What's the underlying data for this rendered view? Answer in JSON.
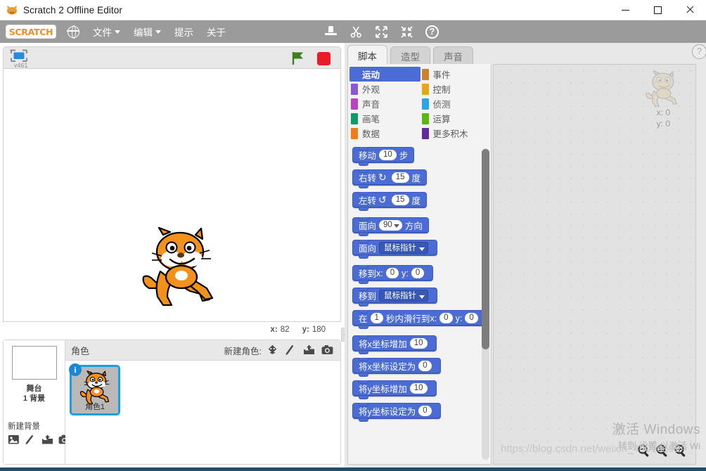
{
  "window": {
    "title": "Scratch 2 Offline Editor",
    "app_icon": "scratch-cat-icon",
    "minimize": "–",
    "maximize": "□",
    "close": "×"
  },
  "menubar": {
    "logo": "SCRATCH",
    "language_icon": "globe-icon",
    "items": [
      {
        "label": "文件",
        "has_caret": true
      },
      {
        "label": "编辑",
        "has_caret": true
      },
      {
        "label": "提示",
        "has_caret": false
      },
      {
        "label": "关于",
        "has_caret": false
      }
    ],
    "tools": [
      {
        "icon": "stamp-icon",
        "glyph": ""
      },
      {
        "icon": "scissors-icon",
        "glyph": "✂"
      },
      {
        "icon": "grow-icon",
        "glyph": "⤡"
      },
      {
        "icon": "shrink-icon",
        "glyph": "⤢"
      },
      {
        "icon": "help-icon",
        "glyph": "?"
      }
    ]
  },
  "stage": {
    "presentation_label": "v461",
    "green_flag_icon": "green-flag-icon",
    "stop_icon": "stop-sign-icon",
    "sprite_image": "scratch-cat",
    "coords": {
      "x_label": "x:",
      "x_value": "82",
      "y_label": "y:",
      "y_value": "180"
    }
  },
  "sprite_pane": {
    "header_title": "角色",
    "new_sprite_label": "新建角色:",
    "new_sprite_icons": [
      "new-sprite-face-icon",
      "paint-brush-icon",
      "upload-file-icon",
      "camera-icon"
    ],
    "stage_selector": {
      "name": "舞台",
      "backdrop_count": "1 背景",
      "new_backdrop_label": "新建背景",
      "new_backdrop_icons": [
        "image-library-icon",
        "paint-brush-icon",
        "upload-file-icon",
        "camera-icon"
      ]
    },
    "sprites": [
      {
        "name": "角色1",
        "badge": "i",
        "selected": true
      }
    ]
  },
  "editor": {
    "tabs": [
      {
        "label": "脚本",
        "active": true
      },
      {
        "label": "造型",
        "active": false
      },
      {
        "label": "声音",
        "active": false
      }
    ],
    "categories": [
      {
        "label": "运动",
        "color": "#4a6cd4",
        "selected": true
      },
      {
        "label": "事件",
        "color": "#c88330",
        "selected": false
      },
      {
        "label": "外观",
        "color": "#8a55d7",
        "selected": false
      },
      {
        "label": "控制",
        "color": "#e1a91a",
        "selected": false
      },
      {
        "label": "声音",
        "color": "#bb42c3",
        "selected": false
      },
      {
        "label": "侦测",
        "color": "#2ca5e2",
        "selected": false
      },
      {
        "label": "画笔",
        "color": "#0e9a6c",
        "selected": false
      },
      {
        "label": "运算",
        "color": "#5cb712",
        "selected": false
      },
      {
        "label": "数据",
        "color": "#ee7d16",
        "selected": false
      },
      {
        "label": "更多积木",
        "color": "#632d99",
        "selected": false
      }
    ],
    "blocks": [
      {
        "id": "move-steps",
        "parts": [
          {
            "t": "text",
            "v": "移动"
          },
          {
            "t": "num",
            "v": "10"
          },
          {
            "t": "text",
            "v": "步"
          }
        ]
      },
      {
        "id": "turn-right",
        "parts": [
          {
            "t": "text",
            "v": "右转"
          },
          {
            "t": "icon",
            "v": "↻"
          },
          {
            "t": "num",
            "v": "15"
          },
          {
            "t": "text",
            "v": "度"
          }
        ]
      },
      {
        "id": "turn-left",
        "parts": [
          {
            "t": "text",
            "v": "左转"
          },
          {
            "t": "icon",
            "v": "↺"
          },
          {
            "t": "num",
            "v": "15"
          },
          {
            "t": "text",
            "v": "度"
          }
        ]
      },
      {
        "id": "point-direction",
        "gap": true,
        "parts": [
          {
            "t": "text",
            "v": "面向"
          },
          {
            "t": "drop",
            "v": "90"
          },
          {
            "t": "text",
            "v": "方向"
          }
        ]
      },
      {
        "id": "point-towards",
        "parts": [
          {
            "t": "text",
            "v": "面向"
          },
          {
            "t": "field",
            "v": "鼠标指针"
          }
        ]
      },
      {
        "id": "go-to-xy",
        "gap": true,
        "parts": [
          {
            "t": "text",
            "v": "移到"
          },
          {
            "t": "text",
            "v": "x:"
          },
          {
            "t": "num",
            "v": "0"
          },
          {
            "t": "text",
            "v": "y:"
          },
          {
            "t": "num",
            "v": "0"
          }
        ]
      },
      {
        "id": "go-to-target",
        "parts": [
          {
            "t": "text",
            "v": "移到"
          },
          {
            "t": "field",
            "v": "鼠标指针"
          }
        ]
      },
      {
        "id": "glide-secs-xy",
        "parts": [
          {
            "t": "text",
            "v": "在"
          },
          {
            "t": "num",
            "v": "1"
          },
          {
            "t": "text",
            "v": "秒内滑行到"
          },
          {
            "t": "text",
            "v": "x:"
          },
          {
            "t": "num",
            "v": "0"
          },
          {
            "t": "text",
            "v": "y:"
          },
          {
            "t": "num",
            "v": "0"
          }
        ]
      },
      {
        "id": "change-x-by",
        "gap": true,
        "parts": [
          {
            "t": "text",
            "v": "将x坐标增加"
          },
          {
            "t": "num",
            "v": "10"
          }
        ]
      },
      {
        "id": "set-x-to",
        "parts": [
          {
            "t": "text",
            "v": "将x坐标设定为"
          },
          {
            "t": "num",
            "v": "0"
          }
        ]
      },
      {
        "id": "change-y-by",
        "parts": [
          {
            "t": "text",
            "v": "将y坐标增加"
          },
          {
            "t": "num",
            "v": "10"
          }
        ]
      },
      {
        "id": "set-y-to",
        "parts": [
          {
            "t": "text",
            "v": "将y坐标设定为"
          },
          {
            "t": "num",
            "v": "0"
          }
        ]
      }
    ],
    "canvas": {
      "watermark_sprite": "scratch-cat-watermark",
      "x_label": "x:",
      "x_value": "0",
      "y_label": "y:",
      "y_value": "0",
      "help_glyph": "?",
      "zoom_out_icon": "zoom-out-icon",
      "zoom_reset_icon": "zoom-reset-icon",
      "zoom_in_icon": "zoom-in-icon"
    }
  },
  "watermarks": {
    "activate_line1": "激活 Windows",
    "activate_line2": "转到 设置 以激活 Wi",
    "blog_url": "https://blog.csdn.net/weixin_45016199"
  },
  "colors": {
    "motion_blue": "#4a6cd4",
    "menubar_grey": "#9b9b9b",
    "scratch_orange": "#f28c22",
    "select_blue": "#1aa0e0",
    "stop_red": "#e81e25",
    "flag_green": "#3f7f22"
  }
}
